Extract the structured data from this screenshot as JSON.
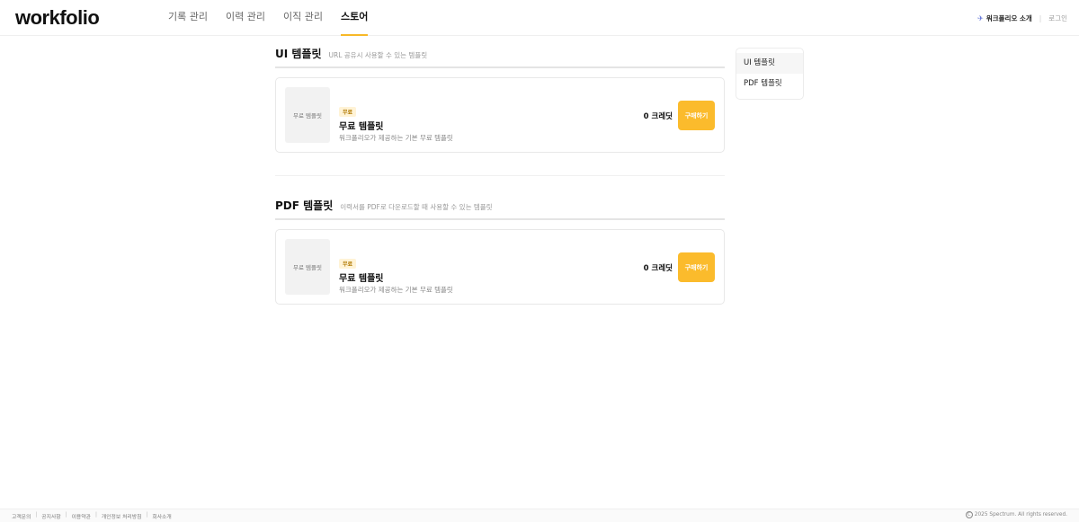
{
  "header": {
    "logo": "workfolio",
    "nav": [
      {
        "label": "기록 관리"
      },
      {
        "label": "이력 관리"
      },
      {
        "label": "이직 관리"
      },
      {
        "label": "스토어"
      }
    ],
    "intro_label": "워크폴리오 소개",
    "intro_icon": "rocket-icon",
    "separator": "|",
    "login_label": "로그인"
  },
  "sections": [
    {
      "title": "UI 템플릿",
      "desc": "URL 공유시 사용할 수 있는 템플릿",
      "item": {
        "thumb_label": "무료 템플릿",
        "badge": "무료",
        "title": "무료 템플릿",
        "desc": "워크폴리오가 제공하는 기본 무료 템플릿",
        "price": "0 크레딧",
        "buy_label": "구매하기"
      }
    },
    {
      "title": "PDF 템플릿",
      "desc": "이력서를 PDF로 다운로드할 때 사용할 수 있는 템플릿",
      "item": {
        "thumb_label": "무료 템플릿",
        "badge": "무료",
        "title": "무료 템플릿",
        "desc": "워크폴리오가 제공하는 기본 무료 템플릿",
        "price": "0 크레딧",
        "buy_label": "구매하기"
      }
    }
  ],
  "side_menu": {
    "items": [
      {
        "label": "UI 템플릿"
      },
      {
        "label": "PDF 템플릿"
      }
    ]
  },
  "footer": {
    "links": [
      {
        "label": "고객문의"
      },
      {
        "label": "공지사항"
      },
      {
        "label": "이용약관"
      },
      {
        "label": "개인정보 처리방침"
      },
      {
        "label": "회사소개"
      }
    ],
    "separator": "|",
    "copyright_symbol": "C",
    "copyright": "2025 Spectrum. All rights reserved."
  },
  "colors": {
    "accent": "#fbbb2c",
    "badge_bg": "#fff3d6",
    "badge_text": "#b07800"
  }
}
